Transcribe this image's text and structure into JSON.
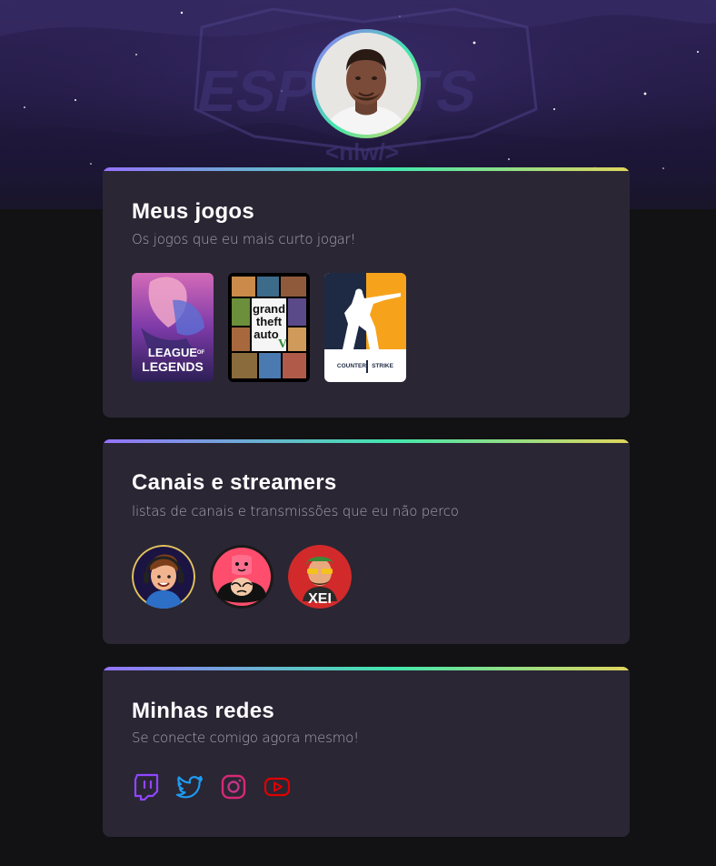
{
  "profile": {
    "background_logo": "ESPORTS nlw"
  },
  "games_card": {
    "title": "Meus jogos",
    "subtitle": "Os jogos que eu mais curto jogar!",
    "games": [
      {
        "name": "LEAGUE OF LEGENDS",
        "top": "LEAGUE",
        "of": "OF",
        "bottom": "LEGENDS"
      },
      {
        "name": "Grand Theft Auto V",
        "l1": "grand",
        "l2": "theft",
        "l3": "auto",
        "l4": "V"
      },
      {
        "name": "COUNTER STRIKE",
        "l1": "COUNTER",
        "l2": "STRIKE"
      }
    ]
  },
  "streamers_card": {
    "title": "Canais e streamers",
    "subtitle": "listas de canais e transmissões que eu não perco",
    "streamers": [
      {
        "icon": "streamer-1-avatar"
      },
      {
        "icon": "streamer-2-avatar"
      },
      {
        "icon": "streamer-3-avatar",
        "label": "XEI"
      }
    ]
  },
  "socials_card": {
    "title": "Minhas redes",
    "subtitle": "Se conecte comigo agora mesmo!",
    "socials": [
      {
        "icon": "twitch-icon",
        "color": "#9146ff"
      },
      {
        "icon": "twitter-icon",
        "color": "#1d9bf0"
      },
      {
        "icon": "instagram-icon",
        "color": "#d62976"
      },
      {
        "icon": "youtube-icon",
        "color": "#e00000"
      }
    ]
  },
  "colors": {
    "background": "#121214",
    "card": "#2a2634",
    "gradient": [
      "#9572fc",
      "#43e7ad",
      "#e1d55d"
    ]
  }
}
